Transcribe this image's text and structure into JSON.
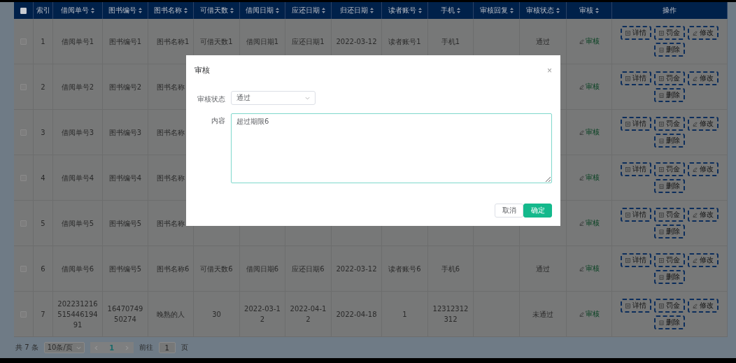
{
  "table": {
    "select_all": {
      "checked": false
    },
    "columns": [
      {
        "label": "索引",
        "sortable": false
      },
      {
        "label": "借阅单号",
        "sortable": true
      },
      {
        "label": "图书编号",
        "sortable": true
      },
      {
        "label": "图书名称",
        "sortable": true
      },
      {
        "label": "可借天数",
        "sortable": true
      },
      {
        "label": "借阅日期",
        "sortable": true
      },
      {
        "label": "应还日期",
        "sortable": true
      },
      {
        "label": "归还日期",
        "sortable": true
      },
      {
        "label": "读者账号",
        "sortable": true
      },
      {
        "label": "手机",
        "sortable": true
      },
      {
        "label": "审核回复",
        "sortable": true
      },
      {
        "label": "审核状态",
        "sortable": true
      },
      {
        "label": "审核",
        "sortable": true
      },
      {
        "label": "操作",
        "sortable": false
      }
    ],
    "rows": [
      {
        "checked": false,
        "cells": [
          "1",
          "借阅单号1",
          "图书编号1",
          "图书名称1",
          "可借天数1",
          "借阅日期1",
          "应还日期1",
          "2022-03-12",
          "读者账号1",
          "手机1",
          "",
          "通过"
        ],
        "review": "审核",
        "actions": [
          {
            "kind": "detail",
            "label": "详情"
          },
          {
            "kind": "fine",
            "label": "罚金"
          },
          {
            "kind": "edit",
            "label": "修改"
          },
          {
            "kind": "delete",
            "label": "删除"
          }
        ]
      },
      {
        "checked": false,
        "cells": [
          "2",
          "借阅单号2",
          "图书编号2",
          "图书名称"
        ],
        "review": "审核",
        "actions": [
          {
            "kind": "detail",
            "label": "详情"
          },
          {
            "kind": "fine",
            "label": "罚金"
          },
          {
            "kind": "edit",
            "label": "修改"
          },
          {
            "kind": "delete",
            "label": "删除"
          }
        ]
      },
      {
        "checked": false,
        "cells": [
          "3",
          "借阅单号3",
          "图书编号3",
          "图书名称"
        ],
        "review": "审核",
        "actions": [
          {
            "kind": "detail",
            "label": "详情"
          },
          {
            "kind": "fine",
            "label": "罚金"
          },
          {
            "kind": "edit",
            "label": "修改"
          },
          {
            "kind": "delete",
            "label": "删除"
          }
        ]
      },
      {
        "checked": false,
        "cells": [
          "4",
          "借阅单号4",
          "图书编号4",
          "图书名称"
        ],
        "review": "审核",
        "actions": [
          {
            "kind": "detail",
            "label": "详情"
          },
          {
            "kind": "fine",
            "label": "罚金"
          },
          {
            "kind": "edit",
            "label": "修改"
          },
          {
            "kind": "delete",
            "label": "删除"
          }
        ]
      },
      {
        "checked": false,
        "cells": [
          "5",
          "借阅单号5",
          "图书编号5",
          "图书名称"
        ],
        "review": "审核",
        "actions": [
          {
            "kind": "detail",
            "label": "详情"
          },
          {
            "kind": "fine",
            "label": "罚金"
          },
          {
            "kind": "edit",
            "label": "修改"
          },
          {
            "kind": "delete",
            "label": "删除"
          }
        ]
      },
      {
        "checked": false,
        "cells": [
          "6",
          "借阅单号6",
          "图书编号5",
          "图书名称6",
          "可借天数6",
          "借阅日期6",
          "应还日期6",
          "2022-03-12",
          "读者账号6",
          "手机6",
          "",
          "通过"
        ],
        "review": "审核",
        "actions": [
          {
            "kind": "detail",
            "label": "详情"
          },
          {
            "kind": "fine",
            "label": "罚金"
          },
          {
            "kind": "edit",
            "label": "修改"
          },
          {
            "kind": "delete",
            "label": "删除"
          }
        ]
      },
      {
        "checked": false,
        "cells": [
          "7",
          "20223121651544619491",
          "1647074950274",
          "晚熟的人",
          "30",
          "2022-03-12",
          "2022-04-12",
          "2022-04-18",
          "1",
          "12312312312",
          "",
          "未通过"
        ],
        "review": "审核",
        "actions": [
          {
            "kind": "detail",
            "label": "详情"
          },
          {
            "kind": "fine",
            "label": "罚金"
          },
          {
            "kind": "edit",
            "label": "修改"
          },
          {
            "kind": "delete",
            "label": "删除"
          }
        ]
      }
    ]
  },
  "pagination": {
    "total": "共 7 条",
    "page_size": "10条/页",
    "current_page": "1",
    "goto_label": "前往",
    "goto_value": "1",
    "goto_suffix": "页"
  },
  "dialog": {
    "title": "审核",
    "close": "×",
    "status_label": "审核状态",
    "status_value": "通过",
    "content_label": "内容",
    "content_value": "超过期限6",
    "buttons": [
      {
        "kind": "cancel",
        "label": "取消"
      },
      {
        "kind": "confirm",
        "label": "确定"
      }
    ]
  }
}
